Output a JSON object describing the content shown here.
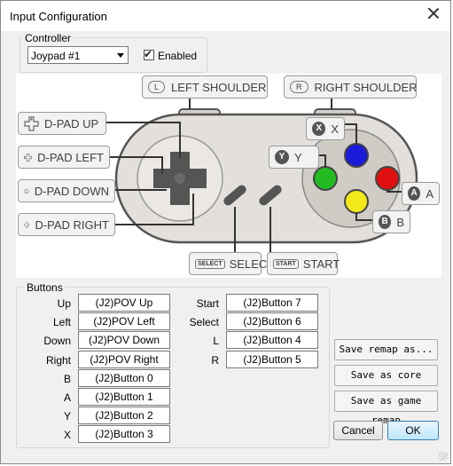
{
  "window": {
    "title": "Input Configuration"
  },
  "controller": {
    "group_label": "Controller",
    "selected": "Joypad #1",
    "enabled_label": "Enabled",
    "enabled": true
  },
  "diagram": {
    "left_shoulder": "LEFT SHOULDER",
    "left_shoulder_key": "L",
    "right_shoulder": "RIGHT SHOULDER",
    "right_shoulder_key": "R",
    "dpad_up": "D-PAD UP",
    "dpad_left": "D-PAD LEFT",
    "dpad_down": "D-PAD DOWN",
    "dpad_right": "D-PAD RIGHT",
    "x": "X",
    "y": "Y",
    "a": "A",
    "b": "B",
    "select": "SELECT",
    "select_key": "SELECT",
    "start": "START",
    "start_key": "START",
    "colors": {
      "x": "#1a1ad8",
      "y": "#22bb22",
      "a": "#e01010",
      "b": "#f2e81a",
      "body": "#e3e0dc",
      "pad": "#cfcbc5"
    }
  },
  "buttons": {
    "group_label": "Buttons",
    "left": [
      {
        "label": "Up",
        "value": "(J2)POV Up"
      },
      {
        "label": "Left",
        "value": "(J2)POV Left"
      },
      {
        "label": "Down",
        "value": "(J2)POV Down"
      },
      {
        "label": "Right",
        "value": "(J2)POV Right"
      },
      {
        "label": "B",
        "value": "(J2)Button 0"
      },
      {
        "label": "A",
        "value": "(J2)Button 1"
      },
      {
        "label": "Y",
        "value": "(J2)Button 2"
      },
      {
        "label": "X",
        "value": "(J2)Button 3"
      }
    ],
    "right": [
      {
        "label": "Start",
        "value": "(J2)Button 7"
      },
      {
        "label": "Select",
        "value": "(J2)Button 6"
      },
      {
        "label": "L",
        "value": "(J2)Button 4"
      },
      {
        "label": "R",
        "value": "(J2)Button 5"
      }
    ]
  },
  "actions": {
    "save_remap_as": "Save remap as...",
    "save_core_remap": "Save as core remap",
    "save_game_remap": "Save as game remap",
    "cancel": "Cancel",
    "ok": "OK"
  }
}
